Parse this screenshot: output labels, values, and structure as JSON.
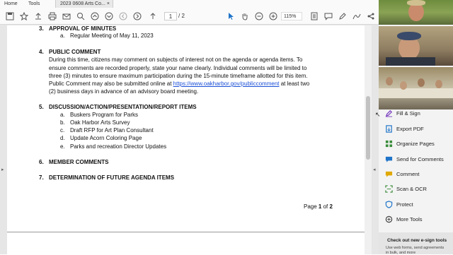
{
  "menubar": {
    "home": "Home",
    "tools": "Tools",
    "doc_tab": "2023 0608 Arts Co...",
    "close": "×"
  },
  "toolbar": {
    "page_current": "1",
    "page_total": "/ 2",
    "zoom": "115%"
  },
  "document": {
    "s3_num": "3.",
    "s3_title": "APPROVAL OF MINUTES",
    "s3a_letter": "a.",
    "s3a_text": "Regular Meeting of May 11, 2023",
    "s4_num": "4.",
    "s4_title": "PUBLIC COMMENT",
    "s4_line1": "During this time, citizens may comment on subjects of interest not on the agenda or agenda items. To",
    "s4_line2": "ensure comments are recorded properly, state your name clearly. Individual comments will be limited to",
    "s4_line3": "three (3) minutes to ensure maximum participation during the 15-minute timeframe allotted for this item.",
    "s4_line4a": "Public Comment may also be submitted online at ",
    "s4_link": "https://www.oakharbor.gov/publiccomment",
    "s4_line4b": " at least two",
    "s4_line5": "(2) business days in advance of an advisory board meeting.",
    "s5_num": "5.",
    "s5_title": "DISCUSSION/ACTION/PRESENTATION/REPORT ITEMS",
    "s5_items": [
      {
        "letter": "a.",
        "text": "Buskers Program for Parks"
      },
      {
        "letter": "b.",
        "text": "Oak Harbor Arts Survey"
      },
      {
        "letter": "c.",
        "text": "Draft RFP for Art Plan Consultant"
      },
      {
        "letter": "d.",
        "text": "Update Acorn Coloring Page"
      },
      {
        "letter": "e.",
        "text": "Parks and recreation Director Updates"
      }
    ],
    "s6_num": "6.",
    "s6_title": "MEMBER COMMENTS",
    "s7_num": "7.",
    "s7_title": "DETERMINATION OF FUTURE AGENDA ITEMS",
    "footer_prefix": "Page ",
    "footer_page": "1",
    "footer_of": " of ",
    "footer_total": "2"
  },
  "tools": [
    {
      "label": "Fill & Sign",
      "icon": "fill-sign-icon",
      "color": "#7b3fbf"
    },
    {
      "label": "Export PDF",
      "icon": "export-pdf-icon",
      "color": "#1f74c9"
    },
    {
      "label": "Organize Pages",
      "icon": "organize-pages-icon",
      "color": "#3a8c3a"
    },
    {
      "label": "Send for Comments",
      "icon": "send-comments-icon",
      "color": "#1f74c9"
    },
    {
      "label": "Comment",
      "icon": "comment-icon",
      "color": "#e0a800"
    },
    {
      "label": "Scan & OCR",
      "icon": "scan-ocr-icon",
      "color": "#3a8c3a"
    },
    {
      "label": "Protect",
      "icon": "protect-icon",
      "color": "#1f74c9"
    },
    {
      "label": "More Tools",
      "icon": "more-tools-icon",
      "color": "#444444"
    }
  ],
  "promo": {
    "title": "Check out new e-sign tools",
    "line1": "Use web forms, send agreements",
    "line2": "in bulk, and more"
  }
}
